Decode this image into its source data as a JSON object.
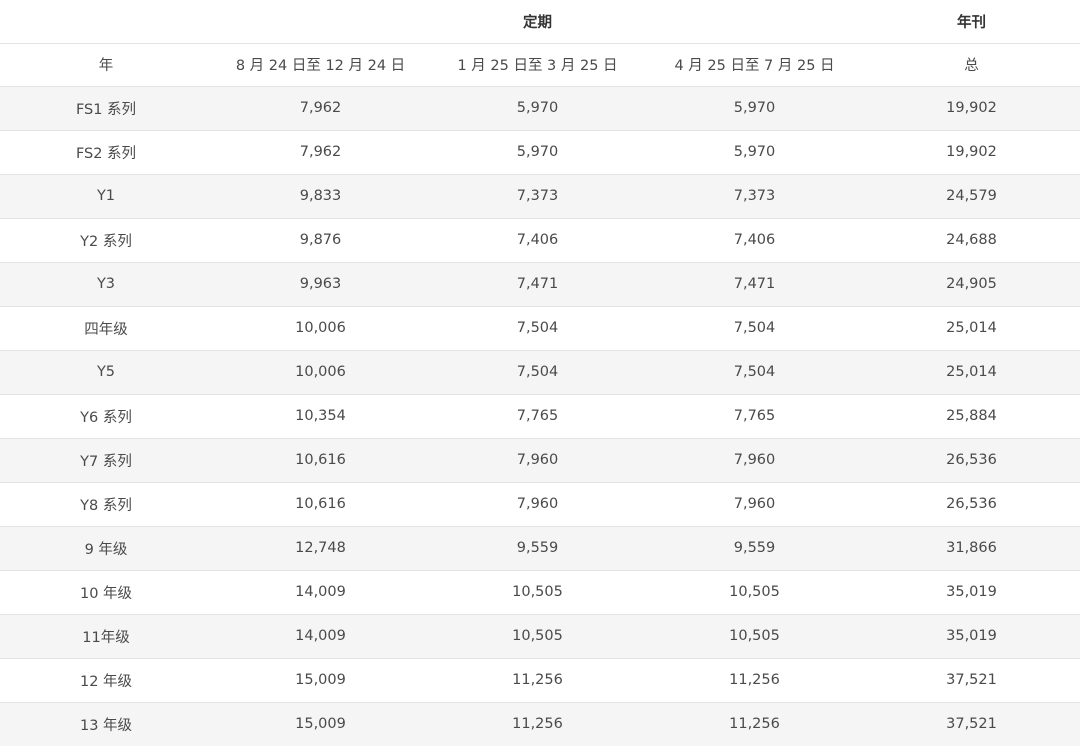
{
  "table": {
    "group_header": [
      "",
      "",
      "定期",
      "",
      "年刊"
    ],
    "column_headers": [
      "年",
      "8 月 24 日至 12 月 24 日",
      "1 月 25 日至 3 月 25 日",
      "4 月 25 日至 7 月 25 日",
      "总"
    ],
    "rows": [
      [
        "FS1 系列",
        "7,962",
        "5,970",
        "5,970",
        "19,902"
      ],
      [
        "FS2 系列",
        "7,962",
        "5,970",
        "5,970",
        "19,902"
      ],
      [
        "Y1",
        "9,833",
        "7,373",
        "7,373",
        "24,579"
      ],
      [
        "Y2 系列",
        "9,876",
        "7,406",
        "7,406",
        "24,688"
      ],
      [
        "Y3",
        "9,963",
        "7,471",
        "7,471",
        "24,905"
      ],
      [
        "四年级",
        "10,006",
        "7,504",
        "7,504",
        "25,014"
      ],
      [
        "Y5",
        "10,006",
        "7,504",
        "7,504",
        "25,014"
      ],
      [
        "Y6 系列",
        "10,354",
        "7,765",
        "7,765",
        "25,884"
      ],
      [
        "Y7 系列",
        "10,616",
        "7,960",
        "7,960",
        "26,536"
      ],
      [
        "Y8 系列",
        "10,616",
        "7,960",
        "7,960",
        "26,536"
      ],
      [
        "9 年级",
        "12,748",
        "9,559",
        "9,559",
        "31,866"
      ],
      [
        "10 年级",
        "14,009",
        "10,505",
        "10,505",
        "35,019"
      ],
      [
        "11年级",
        "14,009",
        "10,505",
        "10,505",
        "35,019"
      ],
      [
        "12 年级",
        "15,009",
        "11,256",
        "11,256",
        "37,521"
      ],
      [
        "13 年级",
        "15,009",
        "11,256",
        "11,256",
        "37,521"
      ]
    ]
  }
}
